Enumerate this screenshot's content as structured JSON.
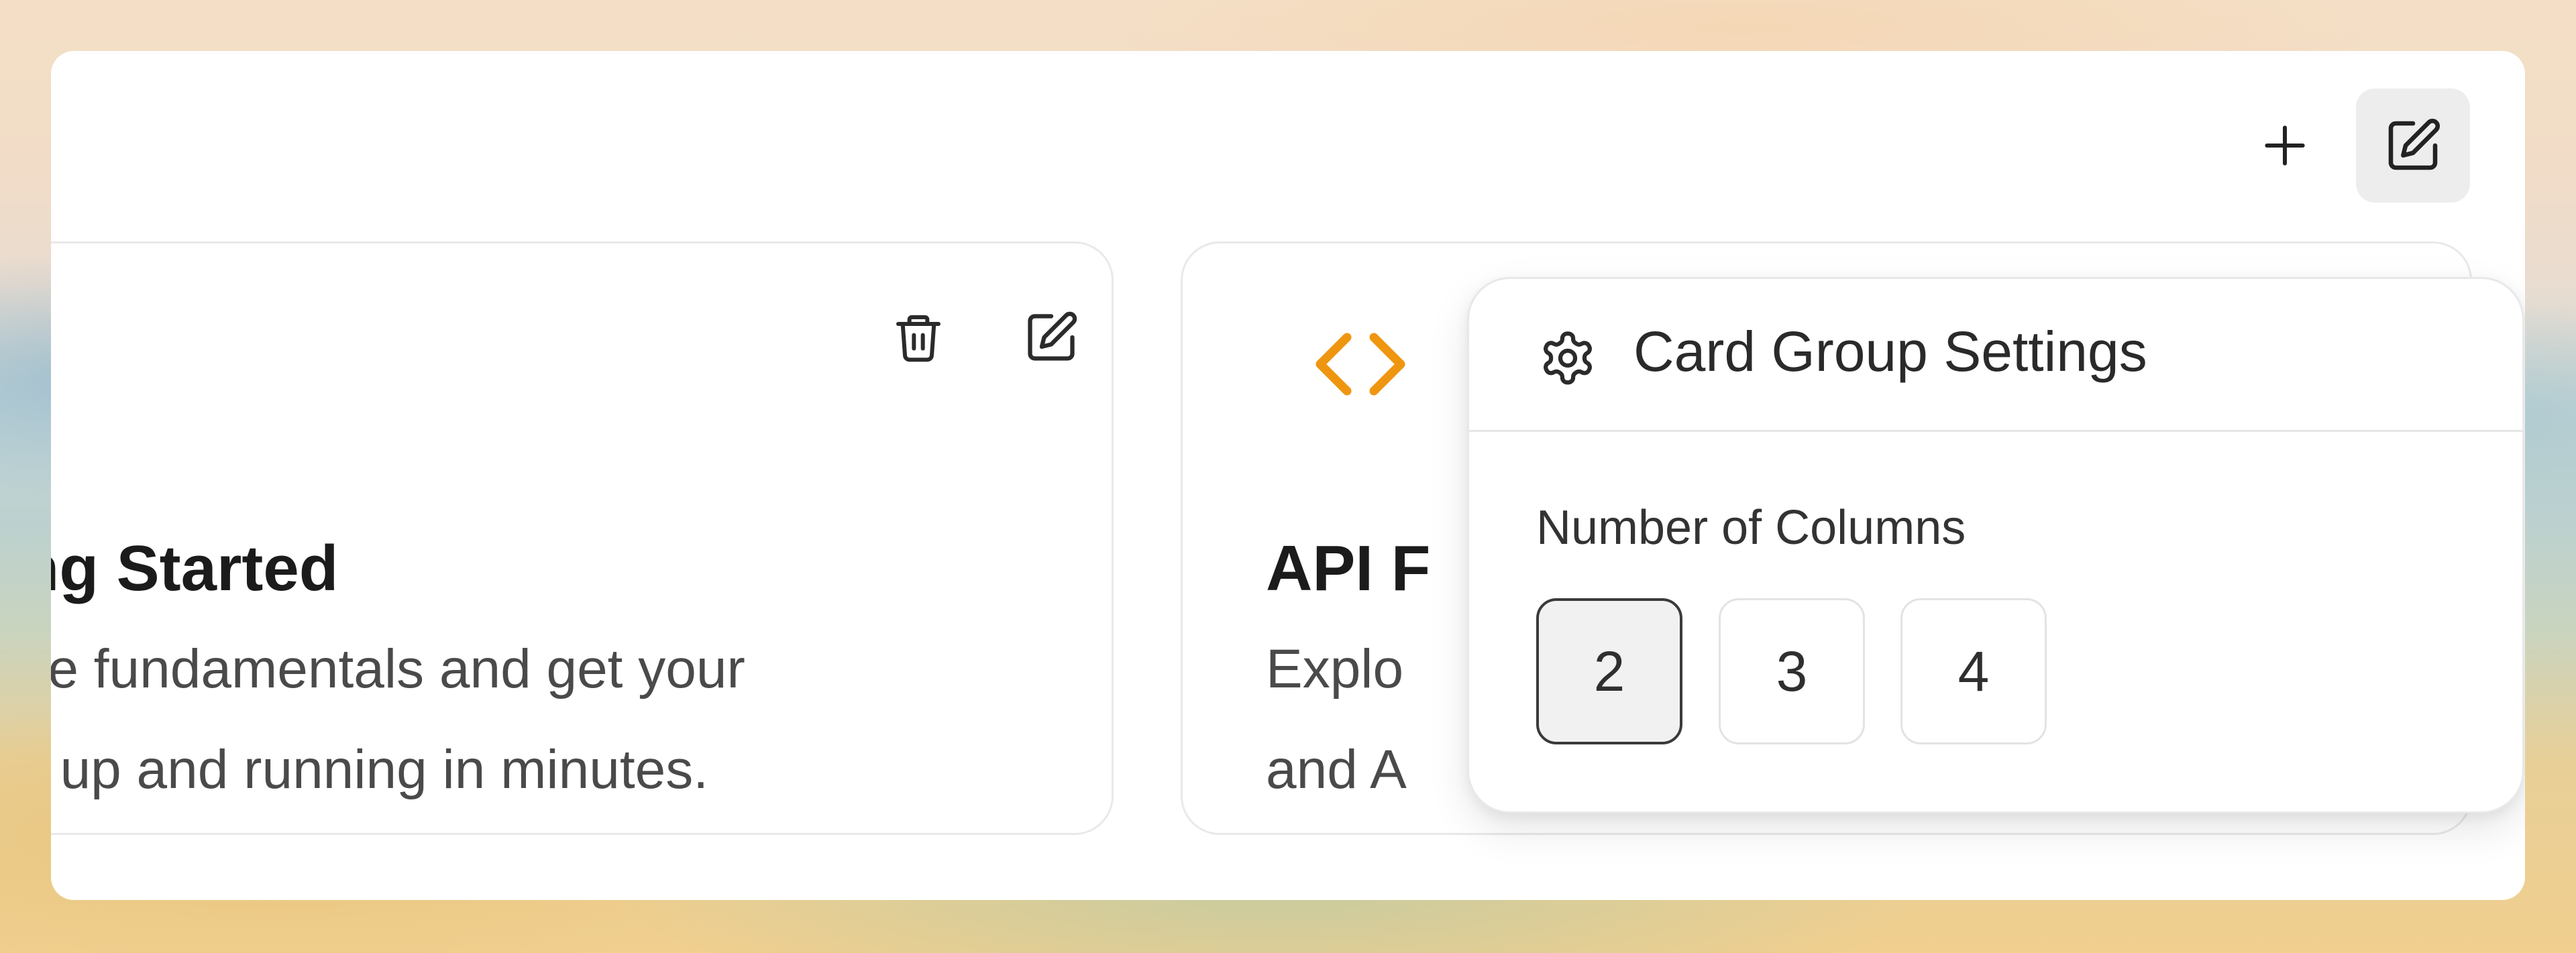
{
  "toolbar": {
    "add_icon": "plus-icon",
    "edit_icon": "edit-square-icon"
  },
  "cards": [
    {
      "title": "ing Started",
      "description_lines": [
        "the fundamentals and get your",
        "ct up and running in minutes."
      ],
      "actions": [
        "trash-icon",
        "edit-square-icon"
      ]
    },
    {
      "icon": "code-icon",
      "title": "API F",
      "description_lines": [
        "Explo",
        "and A"
      ]
    }
  ],
  "popover": {
    "title": "Card Group Settings",
    "icon": "gear-icon",
    "columns_label": "Number of Columns",
    "column_options": [
      "2",
      "3",
      "4"
    ],
    "selected_columns": "2"
  },
  "colors": {
    "accent": "#ef9610",
    "panel": "#ffffff",
    "text": "#1b1b1b"
  }
}
